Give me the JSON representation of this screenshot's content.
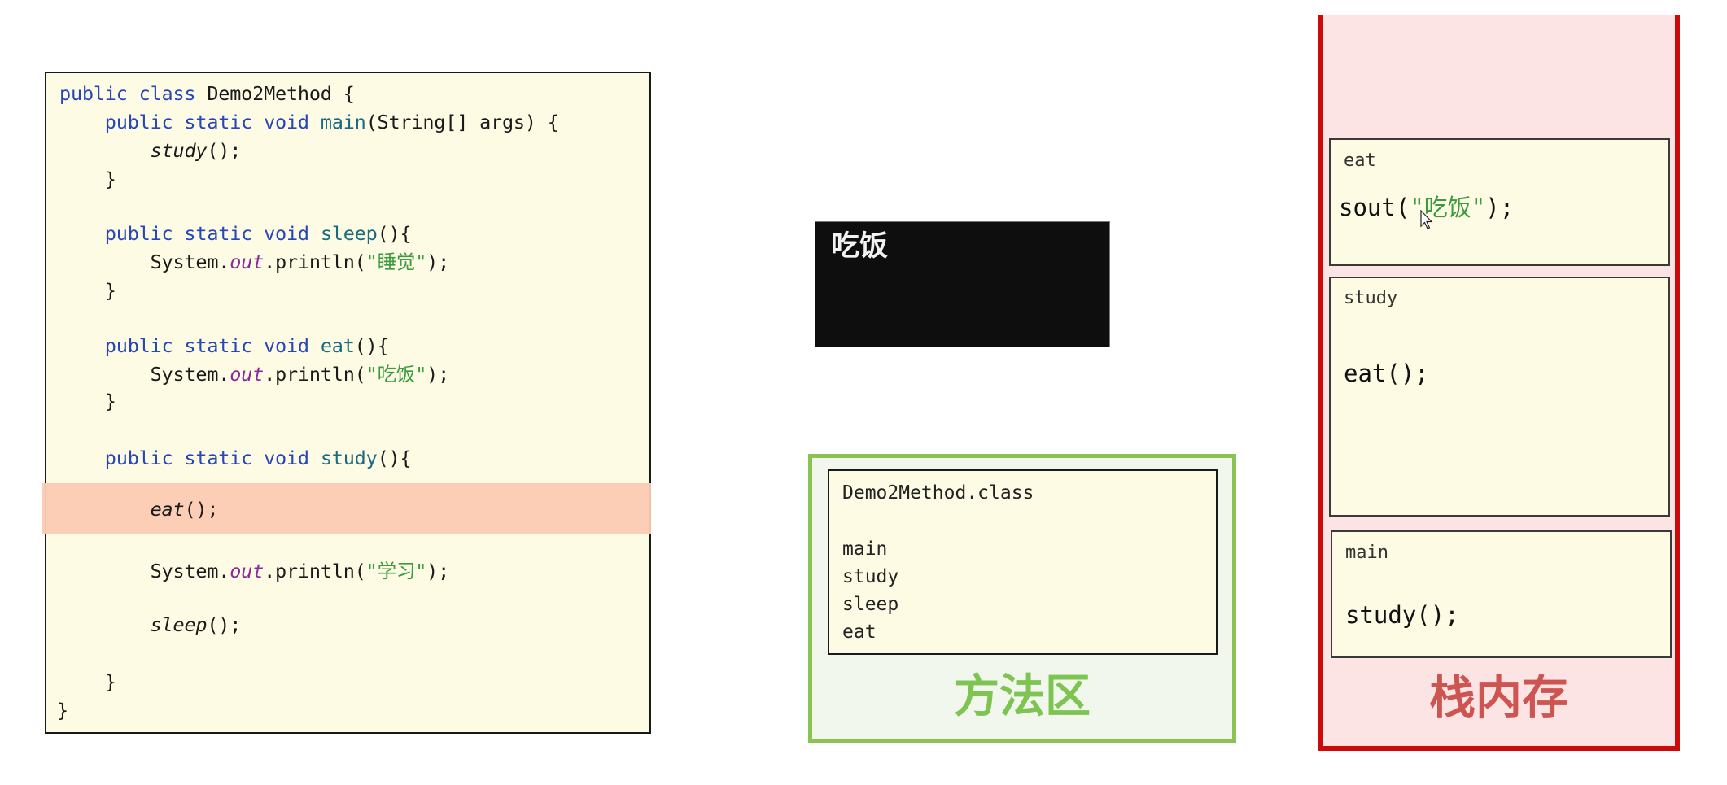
{
  "code": {
    "lines": [
      {
        "parts": [
          {
            "t": "public class ",
            "c": "kw"
          },
          {
            "t": "Demo2Method {",
            "c": ""
          }
        ]
      },
      {
        "parts": [
          {
            "t": "    public static void ",
            "c": "kw"
          },
          {
            "t": "main",
            "c": "fn"
          },
          {
            "t": "(String[] args) {",
            "c": ""
          }
        ]
      },
      {
        "parts": [
          {
            "t": "        ",
            "c": ""
          },
          {
            "t": "study",
            "c": "it"
          },
          {
            "t": "();",
            "c": ""
          }
        ]
      },
      {
        "parts": [
          {
            "t": "    }",
            "c": ""
          }
        ]
      },
      {
        "parts": [
          {
            "t": "    public static void ",
            "c": "kw"
          },
          {
            "t": "sleep",
            "c": "fn"
          },
          {
            "t": "(){",
            "c": ""
          }
        ]
      },
      {
        "parts": [
          {
            "t": "        System.",
            "c": ""
          },
          {
            "t": "out",
            "c": "fld"
          },
          {
            "t": ".println(",
            "c": ""
          },
          {
            "t": "\"睡觉\"",
            "c": "str"
          },
          {
            "t": ");",
            "c": ""
          }
        ]
      },
      {
        "parts": [
          {
            "t": "    }",
            "c": ""
          }
        ]
      },
      {
        "parts": [
          {
            "t": "    public static void ",
            "c": "kw"
          },
          {
            "t": "eat",
            "c": "fn"
          },
          {
            "t": "(){",
            "c": ""
          }
        ]
      },
      {
        "parts": [
          {
            "t": "        System.",
            "c": ""
          },
          {
            "t": "out",
            "c": "fld"
          },
          {
            "t": ".println(",
            "c": ""
          },
          {
            "t": "\"吃饭\"",
            "c": "str"
          },
          {
            "t": ");",
            "c": ""
          }
        ]
      },
      {
        "parts": [
          {
            "t": "    }",
            "c": ""
          }
        ]
      },
      {
        "parts": [
          {
            "t": "    public static void ",
            "c": "kw"
          },
          {
            "t": "study",
            "c": "fn"
          },
          {
            "t": "(){",
            "c": ""
          }
        ]
      },
      {
        "parts": [
          {
            "t": "        ",
            "c": ""
          },
          {
            "t": "eat",
            "c": "it"
          },
          {
            "t": "();",
            "c": ""
          }
        ],
        "highlighted": true
      },
      {
        "parts": [
          {
            "t": "        System.",
            "c": ""
          },
          {
            "t": "out",
            "c": "fld"
          },
          {
            "t": ".println(",
            "c": ""
          },
          {
            "t": "\"学习\"",
            "c": "str"
          },
          {
            "t": ");",
            "c": ""
          }
        ]
      },
      {
        "parts": [
          {
            "t": "        ",
            "c": ""
          },
          {
            "t": "sleep",
            "c": "it"
          },
          {
            "t": "();",
            "c": ""
          }
        ]
      },
      {
        "parts": [
          {
            "t": "    }",
            "c": ""
          }
        ]
      },
      {
        "parts": [
          {
            "t": "}",
            "c": ""
          }
        ]
      }
    ],
    "highlighted_line": "eat();"
  },
  "console": {
    "output": "吃饭"
  },
  "method_area": {
    "label": "方法区",
    "class_name": "Demo2Method.class",
    "methods": [
      "main",
      "study",
      "sleep",
      "eat"
    ]
  },
  "stack": {
    "label": "栈内存",
    "frames": [
      {
        "name": "eat",
        "code_prefix": "sout(",
        "code_string": "\"吃饭\"",
        "code_suffix": ");"
      },
      {
        "name": "study",
        "code": "eat();"
      },
      {
        "name": "main",
        "code": "study();"
      }
    ]
  },
  "colors": {
    "keyword": "#2746b8",
    "method_name": "#1a6b80",
    "string": "#3c9a3f",
    "field": "#8a2a9c",
    "highlight": "#fccbb2",
    "method_area_border": "#8cc251",
    "stack_border": "#cc0a0a"
  }
}
